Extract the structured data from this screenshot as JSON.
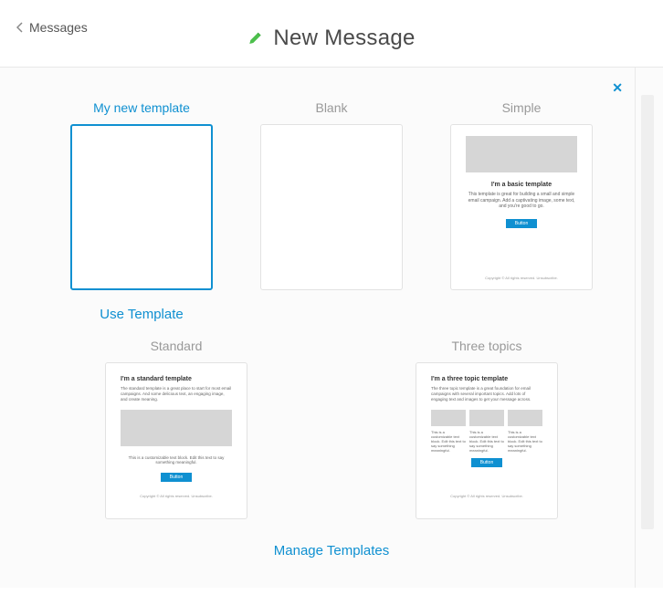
{
  "header": {
    "back_label": "Messages",
    "title": "New Message"
  },
  "close_glyph": "✕",
  "templates": {
    "card1": {
      "label": "My new template",
      "use_label": "Use Template"
    },
    "card2": {
      "label": "Blank"
    },
    "card3": {
      "label": "Simple",
      "preview": {
        "heading": "I'm a basic template",
        "body": "This template is great for building a small and simple email campaign. Add a captivating image, some text, and you're good to go.",
        "button": "Button",
        "footer": "Copyright © All rights reserved. Unsubscribe."
      }
    },
    "card4": {
      "label": "Standard",
      "preview": {
        "heading": "I'm a standard template",
        "body1": "The standard template is a great place to start for most email campaigns. And some delicious text, an engaging image, and create meaning.",
        "body2": "This is a customizable text block. Edit this text to say something meaningful.",
        "button": "Button",
        "footer": "Copyright © All rights reserved. Unsubscribe."
      }
    },
    "card5": {
      "label": "Three topics",
      "preview": {
        "heading": "I'm a three topic template",
        "body": "The three topic template is a great foundation for email campaigns with several important topics. Add lots of engaging text and images to get your message across.",
        "col1": "This is a customizable text block. Edit this text to say something meaningful.",
        "col2": "This is a customizable text block. Edit this text to say something meaningful.",
        "col3": "This is a customizable text block. Edit this text to say something meaningful.",
        "button": "Button",
        "footer": "Copyright © All rights reserved. Unsubscribe."
      }
    }
  },
  "footer": {
    "manage": "Manage Templates"
  }
}
